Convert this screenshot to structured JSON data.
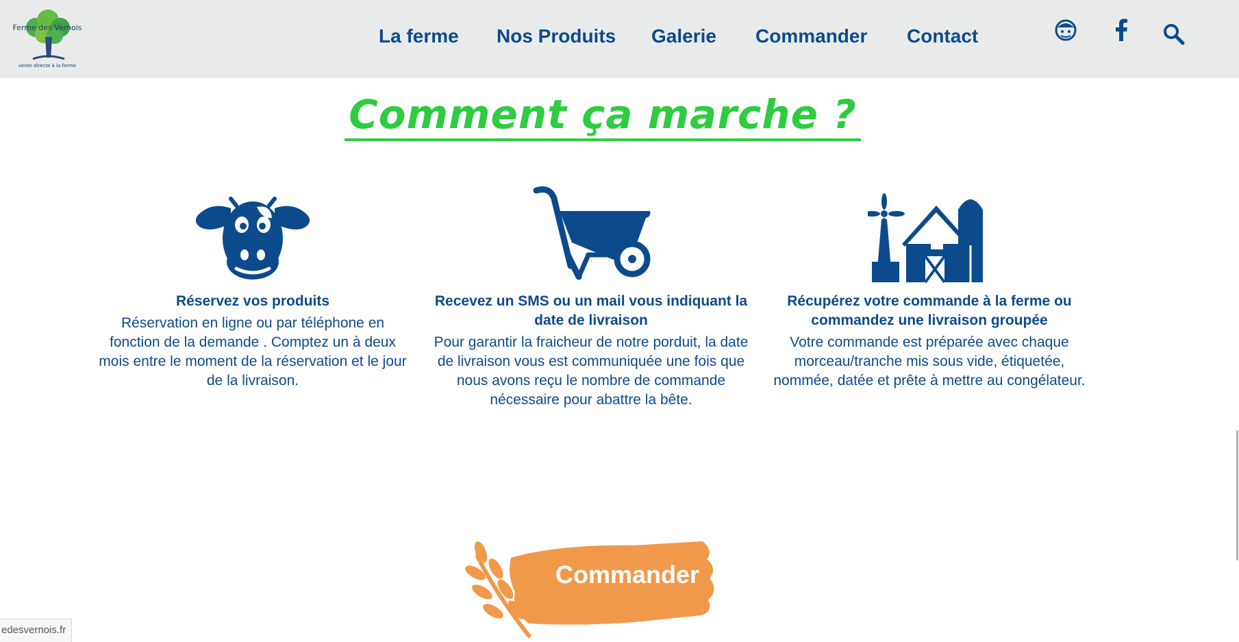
{
  "header": {
    "logo": {
      "name": "Ferme des Vernois",
      "tagline": "vente directe à la ferme",
      "icon": "tree-logo-icon"
    },
    "nav": [
      {
        "label": "La ferme"
      },
      {
        "label": "Nos Produits"
      },
      {
        "label": "Galerie"
      },
      {
        "label": "Commander"
      },
      {
        "label": "Contact"
      }
    ],
    "icons": [
      "account-icon",
      "facebook-icon",
      "search-icon"
    ]
  },
  "main": {
    "heading": "Comment ça marche ?",
    "steps": [
      {
        "icon": "cow-icon",
        "title": "Réservez vos produits",
        "text": "Réservation en ligne ou par téléphone en fonction de la demande . Comptez un à deux mois entre le moment de la réservation et le jour de la livraison."
      },
      {
        "icon": "wheelbarrow-icon",
        "title": "Recevez un SMS ou un mail vous indiquant la date de livraison",
        "text": "Pour garantir la fraicheur de notre porduit, la date de livraison vous est communiquée une fois que nous avons reçu le nombre de commande nécessaire pour abattre la bête."
      },
      {
        "icon": "farm-barn-icon",
        "title": "Récupérez votre commande à la ferme ou commandez une livraison groupée",
        "text": "Votre commande est préparée avec chaque morceau/tranche mis sous vide, étiquetée, nommée, datée et prête à mettre au congélateur."
      }
    ],
    "cta": {
      "label": "Commander",
      "icon": "wheat-icon"
    }
  },
  "status_url": "edesvernois.fr",
  "colors": {
    "brand_blue": "#0c4a8c",
    "heading_green": "#2ecc40",
    "cta_orange": "#f0994a",
    "header_bg": "#e9ebea"
  }
}
